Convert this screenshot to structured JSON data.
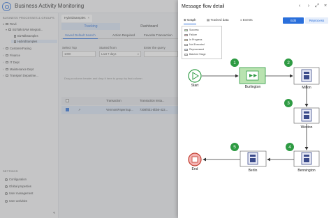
{
  "app": {
    "title": "Business Activity Monitoring"
  },
  "sidebar": {
    "section_label": "BUSINESS PROCESSES & GROUPS",
    "tree": [
      {
        "label": "Rové",
        "caret": "▾",
        "icon": "folder"
      },
      {
        "label": "BizTalk BAM Integrati...",
        "caret": "▾",
        "icon": "folder"
      },
      {
        "label": "BizTalkSamples",
        "caret": "",
        "icon": "doc"
      },
      {
        "label": "HybridSamples",
        "caret": "",
        "icon": "doc"
      },
      {
        "label": "CustomerFacing",
        "caret": "›",
        "icon": "folder"
      },
      {
        "label": "Finance",
        "caret": "›",
        "icon": "folder"
      },
      {
        "label": "IT Dept",
        "caret": "›",
        "icon": "folder"
      },
      {
        "label": "Maintenance Dept",
        "caret": "›",
        "icon": "folder"
      },
      {
        "label": "Transport Departme...",
        "caret": "›",
        "icon": "folder"
      }
    ],
    "settings_label": "SETTINGS",
    "settings_items": [
      "Configuration",
      "Global properties",
      "User management",
      "User activities"
    ],
    "collapse": "«"
  },
  "main": {
    "tab_label": "HybridSamples",
    "tab_close": "×",
    "subtabs": [
      "Tracking",
      "Dashboard"
    ],
    "view_tabs": [
      "Saved Default Search",
      "Action Required",
      "Favorite Transaction"
    ],
    "filters": {
      "top_label": "Select Top",
      "top_value": "1000",
      "started_label": "Started from",
      "started_value": "Last 7 days",
      "enter_label": "Enter the query"
    },
    "group_hint": "Drag a column header and drop it here to group by that column",
    "table": {
      "headers": [
        "Transaction",
        "Transaction Insta..."
      ],
      "rows": [
        {
          "checked": true,
          "arrow": "↗",
          "transaction": "VenmontPaperSup...",
          "instance": "7308f4b1-5bb5-422..."
        }
      ]
    }
  },
  "panel": {
    "title": "Message flow detail",
    "header_buttons": [
      "‹",
      "›",
      "⤢",
      "×"
    ],
    "tabs": [
      "Graph",
      "Tracked data",
      "Events"
    ],
    "edit_label": "Edit",
    "reprocess_label": "Reprocess",
    "legend": [
      {
        "label": "Success",
        "color": "#b9e3b0"
      },
      {
        "label": "Failure",
        "color": "#f4b3b3"
      },
      {
        "label": "In Progress",
        "color": "#ffe0a3"
      },
      {
        "label": "Not Executed",
        "color": "#ffffff"
      },
      {
        "label": "Reprocessed",
        "color": "#c9d8f2"
      },
      {
        "label": "Batched Stage",
        "color": "#e2e2e2"
      }
    ],
    "nodes": [
      {
        "label": "Start"
      },
      {
        "label": "Burlington"
      },
      {
        "label": "Milton"
      },
      {
        "label": "Weston"
      },
      {
        "label": "Bennington"
      },
      {
        "label": "Berlin"
      },
      {
        "label": "End"
      }
    ],
    "steps": [
      "1",
      "2",
      "3",
      "4",
      "5"
    ],
    "colors": {
      "accent": "#2a6fdb",
      "step_badge": "#2e9b43",
      "success_fill": "#b9e3b0",
      "end_fill": "#f4b3b3",
      "node_fill": "#e8eaf6"
    }
  }
}
